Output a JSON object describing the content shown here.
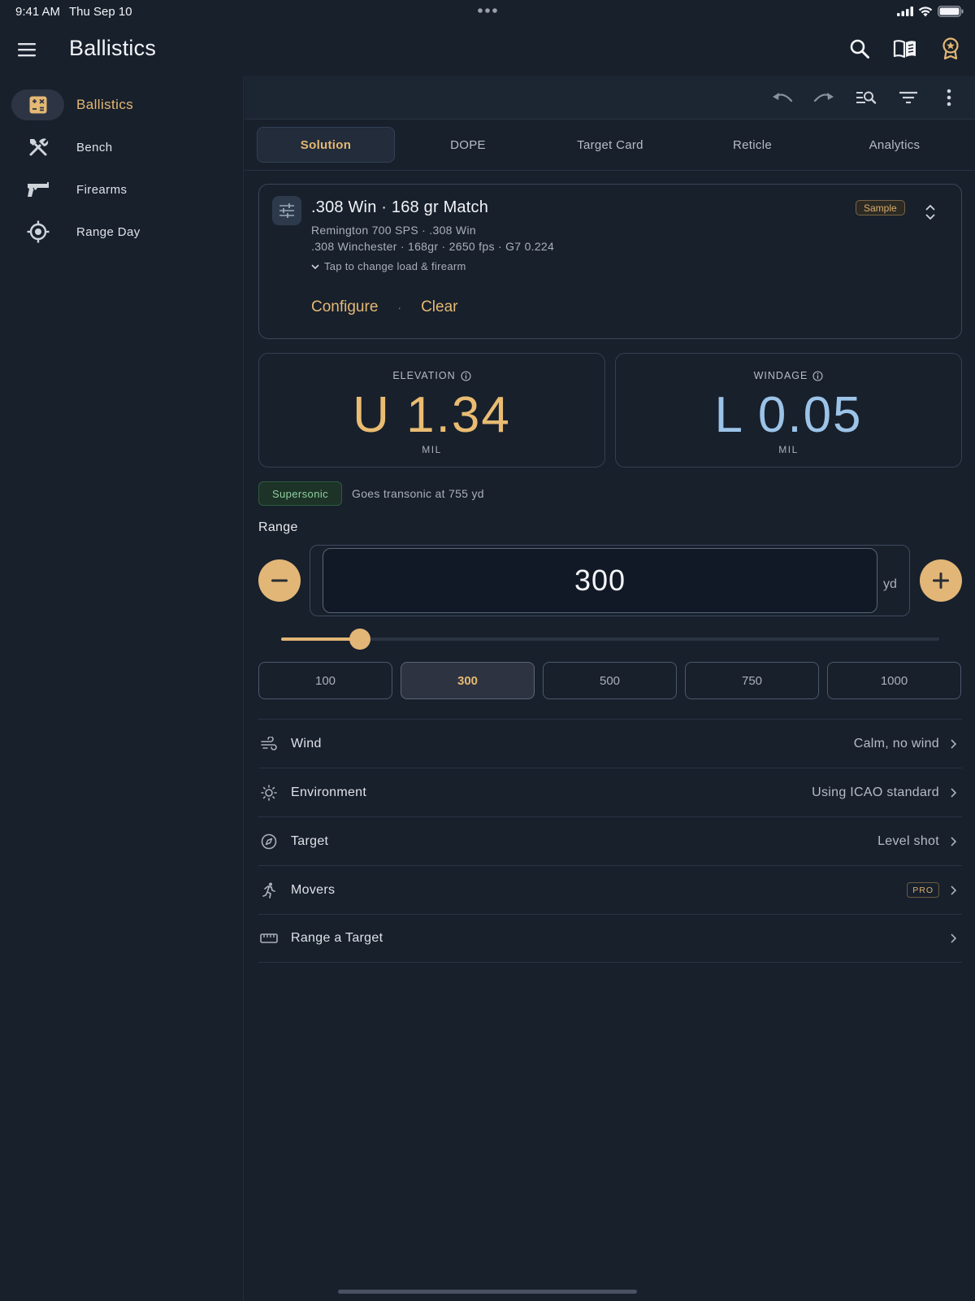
{
  "status": {
    "time": "9:41 AM",
    "date": "Thu Sep 10"
  },
  "app": {
    "title": "Ballistics"
  },
  "header_icons": [
    "search-icon",
    "book-icon",
    "award-icon"
  ],
  "toolbar_icons": [
    "undo-icon",
    "redo-icon",
    "search-list-icon",
    "filter-icon",
    "more-vertical-icon"
  ],
  "sidebar": {
    "items": [
      {
        "label": "Ballistics",
        "icon": "calculator-icon",
        "active": true
      },
      {
        "label": "Bench",
        "icon": "tools-icon",
        "active": false
      },
      {
        "label": "Firearms",
        "icon": "pistol-icon",
        "active": false
      },
      {
        "label": "Range Day",
        "icon": "crosshair-icon",
        "active": false
      }
    ]
  },
  "tabs": [
    {
      "label": "Solution",
      "active": true
    },
    {
      "label": "DOPE",
      "active": false
    },
    {
      "label": "Target Card",
      "active": false
    },
    {
      "label": "Reticle",
      "active": false
    },
    {
      "label": "Analytics",
      "active": false
    }
  ],
  "load": {
    "title": ".308 Win · 168 gr Match",
    "firearm": "Remington 700 SPS · .308 Win",
    "details": ".308 Winchester · 168gr · 2650 fps · G7 0.224",
    "tap_hint": "Tap to change load & firearm",
    "badge": "Sample",
    "configure_label": "Configure",
    "separator": "·",
    "clear_label": "Clear"
  },
  "elevation": {
    "label": "ELEVATION",
    "value": "U 1.34",
    "unit": "MIL",
    "color": "#e9bc72"
  },
  "windage": {
    "label": "WINDAGE",
    "value": "L 0.05",
    "unit": "MIL",
    "color": "#9cc3e8"
  },
  "speed": {
    "badge": "Supersonic",
    "note": "Goes transonic at 755 yd"
  },
  "range": {
    "label": "Range",
    "value": "300",
    "unit": "yd",
    "min": 0,
    "max": 2500,
    "presets": [
      {
        "label": "100",
        "active": false
      },
      {
        "label": "300",
        "active": true
      },
      {
        "label": "500",
        "active": false
      },
      {
        "label": "750",
        "active": false
      },
      {
        "label": "1000",
        "active": false
      }
    ]
  },
  "settings": [
    {
      "label": "Wind",
      "value": "Calm, no wind",
      "icon": "wind-icon"
    },
    {
      "label": "Environment",
      "value": "Using ICAO standard",
      "icon": "sun-icon"
    },
    {
      "label": "Target",
      "value": "Level shot",
      "icon": "compass-icon"
    },
    {
      "label": "Movers",
      "badge": "PRO",
      "icon": "runner-icon"
    },
    {
      "label": "Range a Target",
      "value": "",
      "icon": "ruler-icon"
    }
  ],
  "colors": {
    "accent": "#e5b873",
    "background": "#18202c",
    "supersonic": "#8ecf9f"
  }
}
